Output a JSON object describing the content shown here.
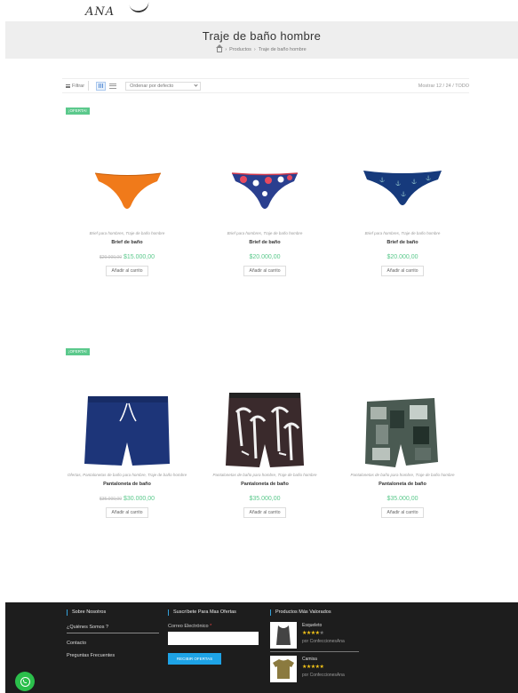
{
  "logo": {
    "text": "ANA"
  },
  "header": {
    "title": "Traje de baño hombre",
    "breadcrumb": [
      "Productos",
      "Traje de baño hombre"
    ]
  },
  "toolbar": {
    "filter_label": "Filtrar",
    "sort_label": "Ordenar por defecto",
    "show_label": "Mostrar",
    "show_options": "12 / 24 / TODO"
  },
  "badges": {
    "ofertas": "¡OFERTA!"
  },
  "products": [
    {
      "category": "Brief para hombres, Traje de baño hombre",
      "name": "Brief de baño",
      "old_price": "$20.000,00",
      "price": "$15.000,00",
      "cart": "Añadir al carrito",
      "color": "#f07a1a"
    },
    {
      "category": "Brief para hombres, Traje de baño hombre",
      "name": "Brief de baño",
      "old_price": "",
      "price": "$20.000,00",
      "cart": "Añadir al carrito",
      "color": "#2a3f8f"
    },
    {
      "category": "Brief para hombres, Traje de baño hombre",
      "name": "Brief de baño",
      "old_price": "",
      "price": "$20.000,00",
      "cart": "Añadir al carrito",
      "color": "#163a7c"
    },
    {
      "category": "Ofertas, Pantalonetas de baño para hombre, Traje de baño hombre",
      "name": "Pantaloneta de baño",
      "old_price": "$35.000,00",
      "price": "$30.000,00",
      "cart": "Añadir al carrito",
      "color": "#1d3579"
    },
    {
      "category": "Pantalonetas de baño para hombre, Traje de baño hombre",
      "name": "Pantaloneta de baño",
      "old_price": "",
      "price": "$35.000,00",
      "cart": "Añadir al carrito",
      "color": "#3a2a2c"
    },
    {
      "category": "Pantalonetas de baño para hombre, Traje de baño hombre",
      "name": "Pantaloneta de baño",
      "old_price": "",
      "price": "$35.000,00",
      "cart": "Añadir al carrito",
      "color": "#4a5a52"
    }
  ],
  "footer": {
    "about_title": "Sobre Nosotros",
    "about_links": [
      "¿Quiénes Somos ?",
      "Contacto",
      "Preguntas Frecuentes"
    ],
    "subscribe_title": "Suscríbete Para Mas Ofertas",
    "email_label": "Correo Electrónico",
    "email_required": "*",
    "subscribe_button": "RECIBIR OFERTAS",
    "rated_title": "Productos Más Valorados",
    "rated": [
      {
        "name": "Esqueleto",
        "stars": "★★★★",
        "empty": "★",
        "by": "por ConfeccionesAna"
      },
      {
        "name": "Camisa",
        "stars": "★★★★★",
        "empty": "",
        "by": "por ConfeccionesAna"
      }
    ]
  }
}
